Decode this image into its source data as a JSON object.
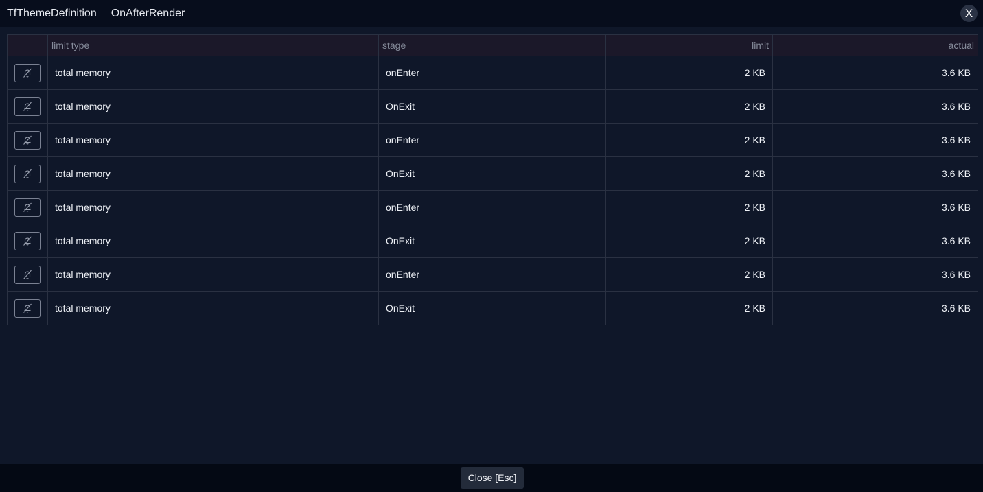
{
  "titlebar": {
    "crumbs": [
      "TfThemeDefinition",
      "OnAfterRender"
    ],
    "close_label": "X"
  },
  "table": {
    "headers": {
      "action": "",
      "limit_type": "limit type",
      "stage": "stage",
      "limit": "limit",
      "actual": "actual"
    },
    "rows": [
      {
        "limit_type": "total memory",
        "stage": "onEnter",
        "limit": "2 KB",
        "actual": "3.6 KB",
        "icon": "bell-off-icon"
      },
      {
        "limit_type": "total memory",
        "stage": "OnExit",
        "limit": "2 KB",
        "actual": "3.6 KB",
        "icon": "bell-off-icon"
      },
      {
        "limit_type": "total memory",
        "stage": "onEnter",
        "limit": "2 KB",
        "actual": "3.6 KB",
        "icon": "bell-off-icon"
      },
      {
        "limit_type": "total memory",
        "stage": "OnExit",
        "limit": "2 KB",
        "actual": "3.6 KB",
        "icon": "bell-off-icon"
      },
      {
        "limit_type": "total memory",
        "stage": "onEnter",
        "limit": "2 KB",
        "actual": "3.6 KB",
        "icon": "bell-off-icon"
      },
      {
        "limit_type": "total memory",
        "stage": "OnExit",
        "limit": "2 KB",
        "actual": "3.6 KB",
        "icon": "bell-off-icon"
      },
      {
        "limit_type": "total memory",
        "stage": "onEnter",
        "limit": "2 KB",
        "actual": "3.6 KB",
        "icon": "bell-off-icon"
      },
      {
        "limit_type": "total memory",
        "stage": "OnExit",
        "limit": "2 KB",
        "actual": "3.6 KB",
        "icon": "bell-off-icon"
      }
    ]
  },
  "footer": {
    "close_button_label": "Close [Esc]"
  },
  "colors": {
    "background": "#0f1729",
    "titlebar": "#070d1c",
    "header_row": "#1b1829",
    "border": "#2a3142"
  }
}
